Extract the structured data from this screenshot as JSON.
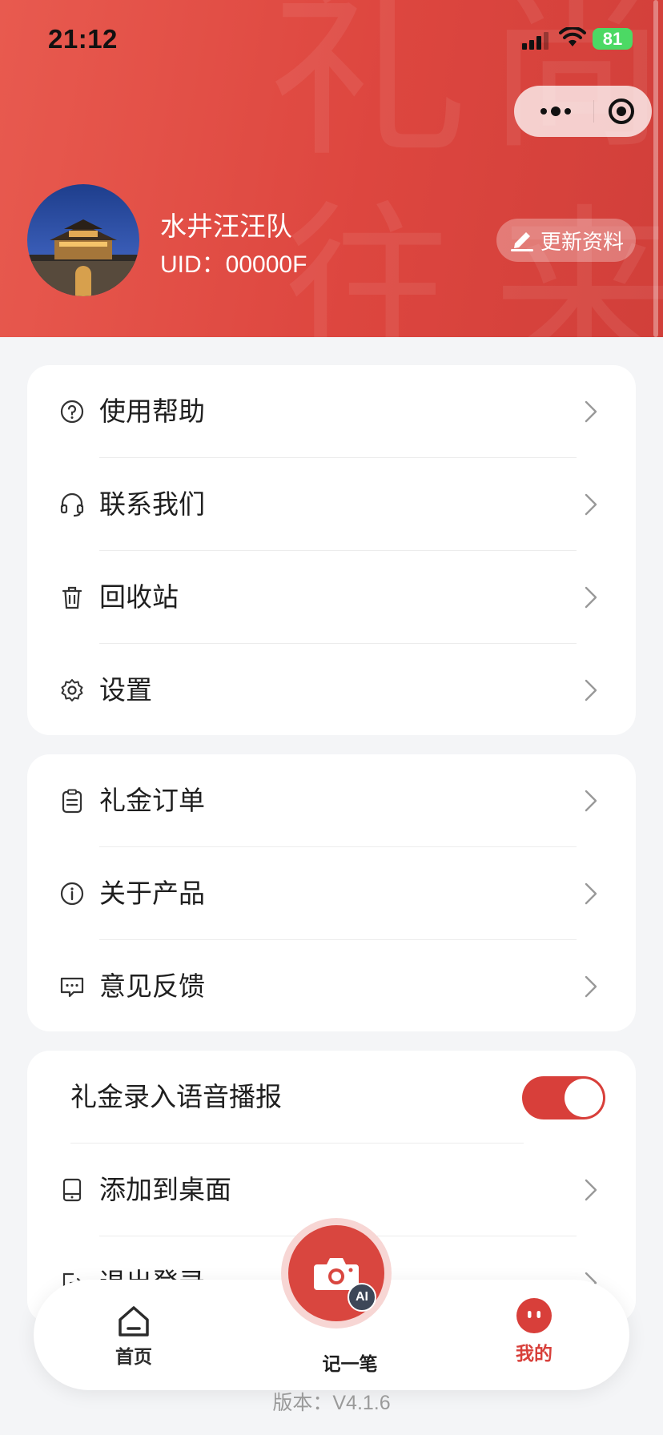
{
  "status_bar": {
    "time": "21:12",
    "battery": "81"
  },
  "header": {
    "watermark": [
      "礼",
      "尚",
      "往",
      "来"
    ],
    "username": "水井汪汪队",
    "uid": "UID：00000F",
    "update_button": "更新资料"
  },
  "menu_group_1": [
    {
      "label": "使用帮助",
      "icon": "help-circle-icon"
    },
    {
      "label": "联系我们",
      "icon": "headset-icon"
    },
    {
      "label": "回收站",
      "icon": "trash-icon"
    },
    {
      "label": "设置",
      "icon": "gear-icon"
    }
  ],
  "menu_group_2": [
    {
      "label": "礼金订单",
      "icon": "clipboard-icon"
    },
    {
      "label": "关于产品",
      "icon": "info-circle-icon"
    },
    {
      "label": "意见反馈",
      "icon": "chat-icon"
    }
  ],
  "menu_group_3": {
    "voice_toggle_label": "礼金录入语音播报",
    "voice_toggle_on": true,
    "items": [
      {
        "label": "添加到桌面",
        "icon": "tablet-icon"
      },
      {
        "label": "退出登录",
        "icon": "logout-icon"
      }
    ]
  },
  "tabbar": {
    "home": "首页",
    "record": "记一笔",
    "record_badge": "AI",
    "mine": "我的"
  },
  "version": "版本：V4.1.6",
  "colors": {
    "brand": "#d83f3a",
    "background": "#f4f5f7"
  }
}
